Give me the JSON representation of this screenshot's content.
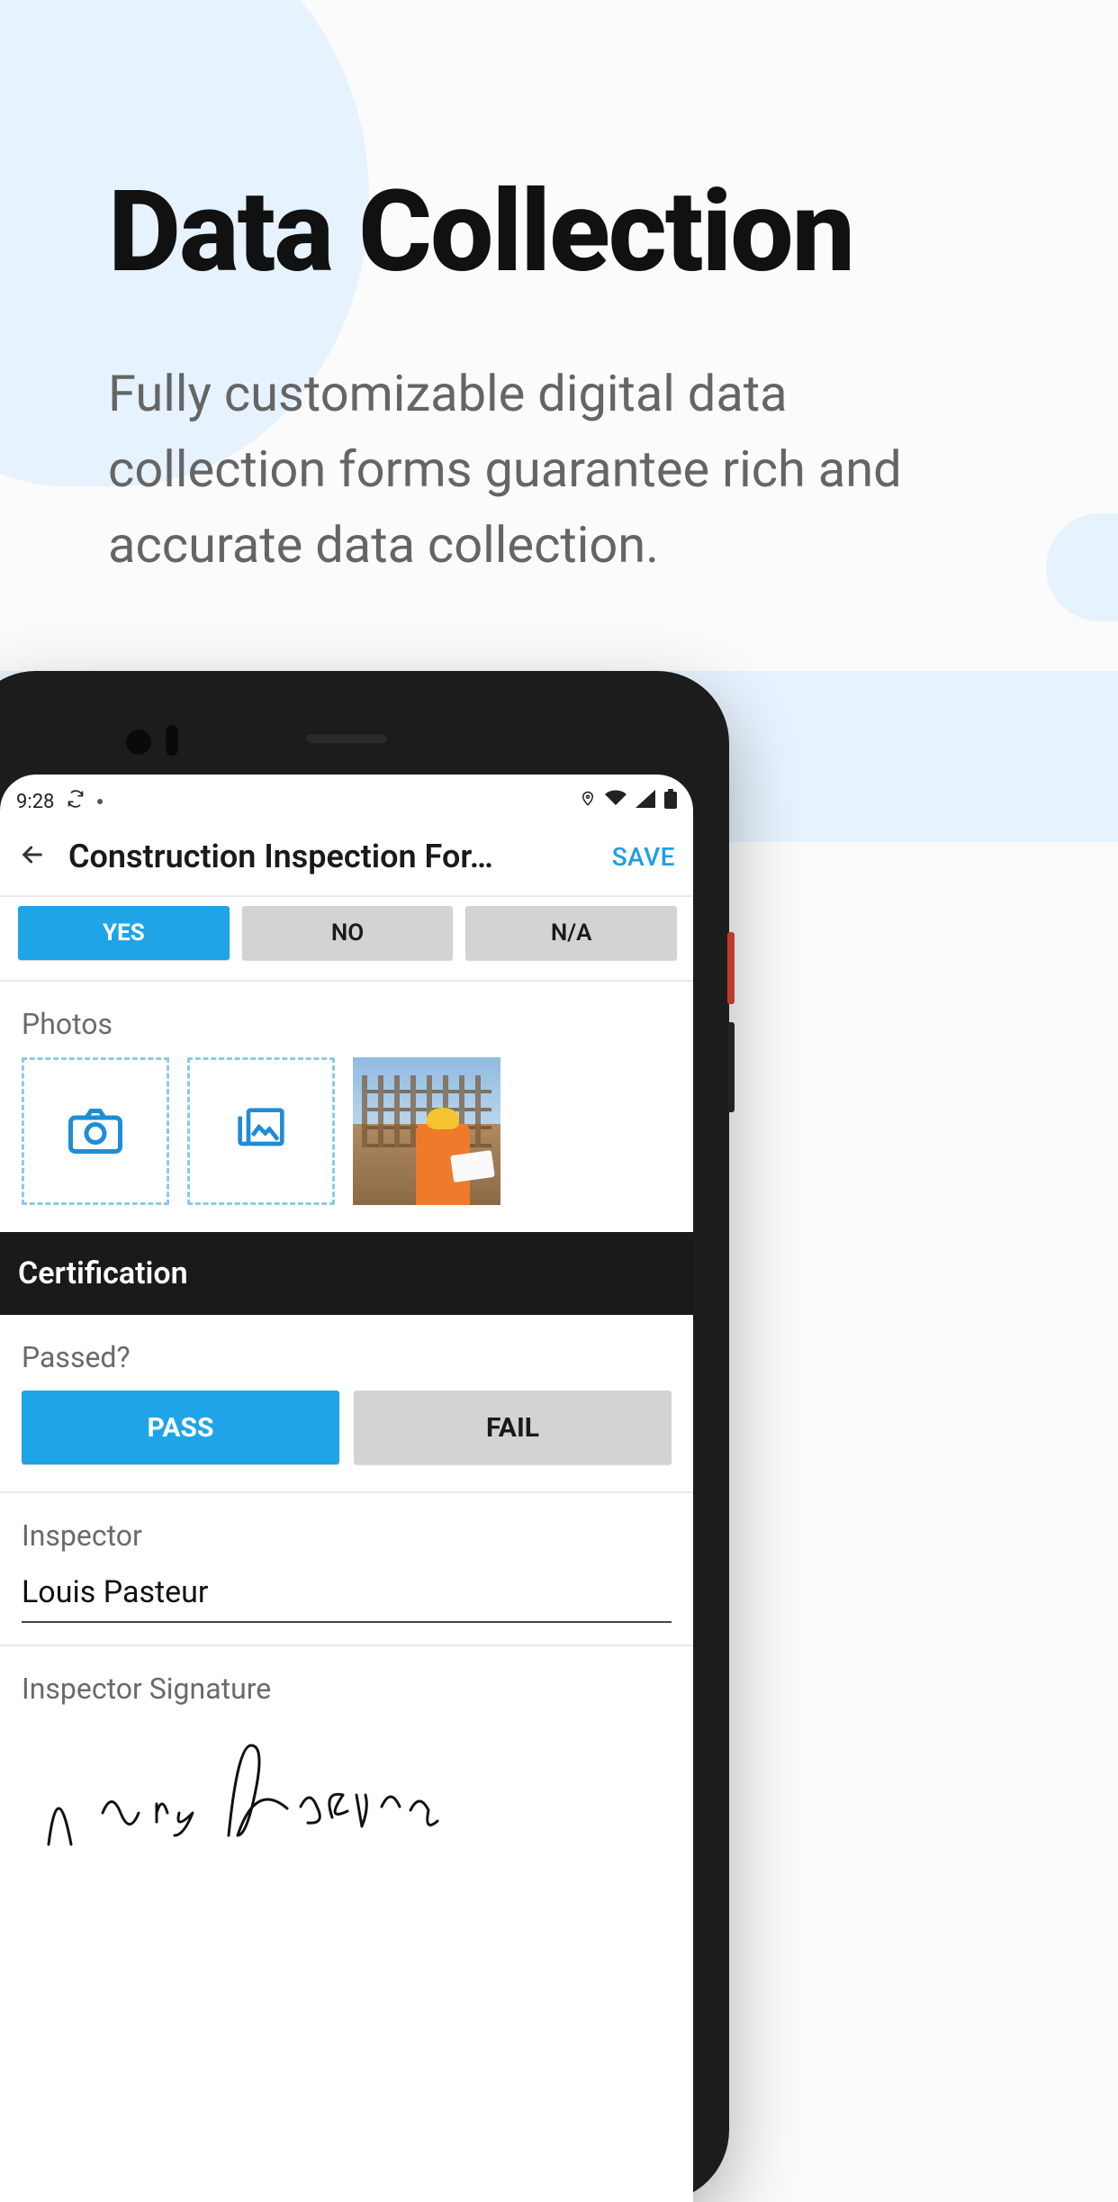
{
  "hero": {
    "title": "Data Collection",
    "subtitle": "Fully customizable digital data collection forms guarantee rich and accurate data collection."
  },
  "status": {
    "time": "9:28"
  },
  "appbar": {
    "title": "Construction Inspection For…",
    "save": "SAVE"
  },
  "tri": {
    "yes": "YES",
    "no": "NO",
    "na": "N/A"
  },
  "photos": {
    "label": "Photos"
  },
  "cert": {
    "header": "Certification",
    "passed_label": "Passed?",
    "pass": "PASS",
    "fail": "FAIL",
    "inspector_label": "Inspector",
    "inspector_value": "Louis Pasteur",
    "signature_label": "Inspector Signature"
  }
}
